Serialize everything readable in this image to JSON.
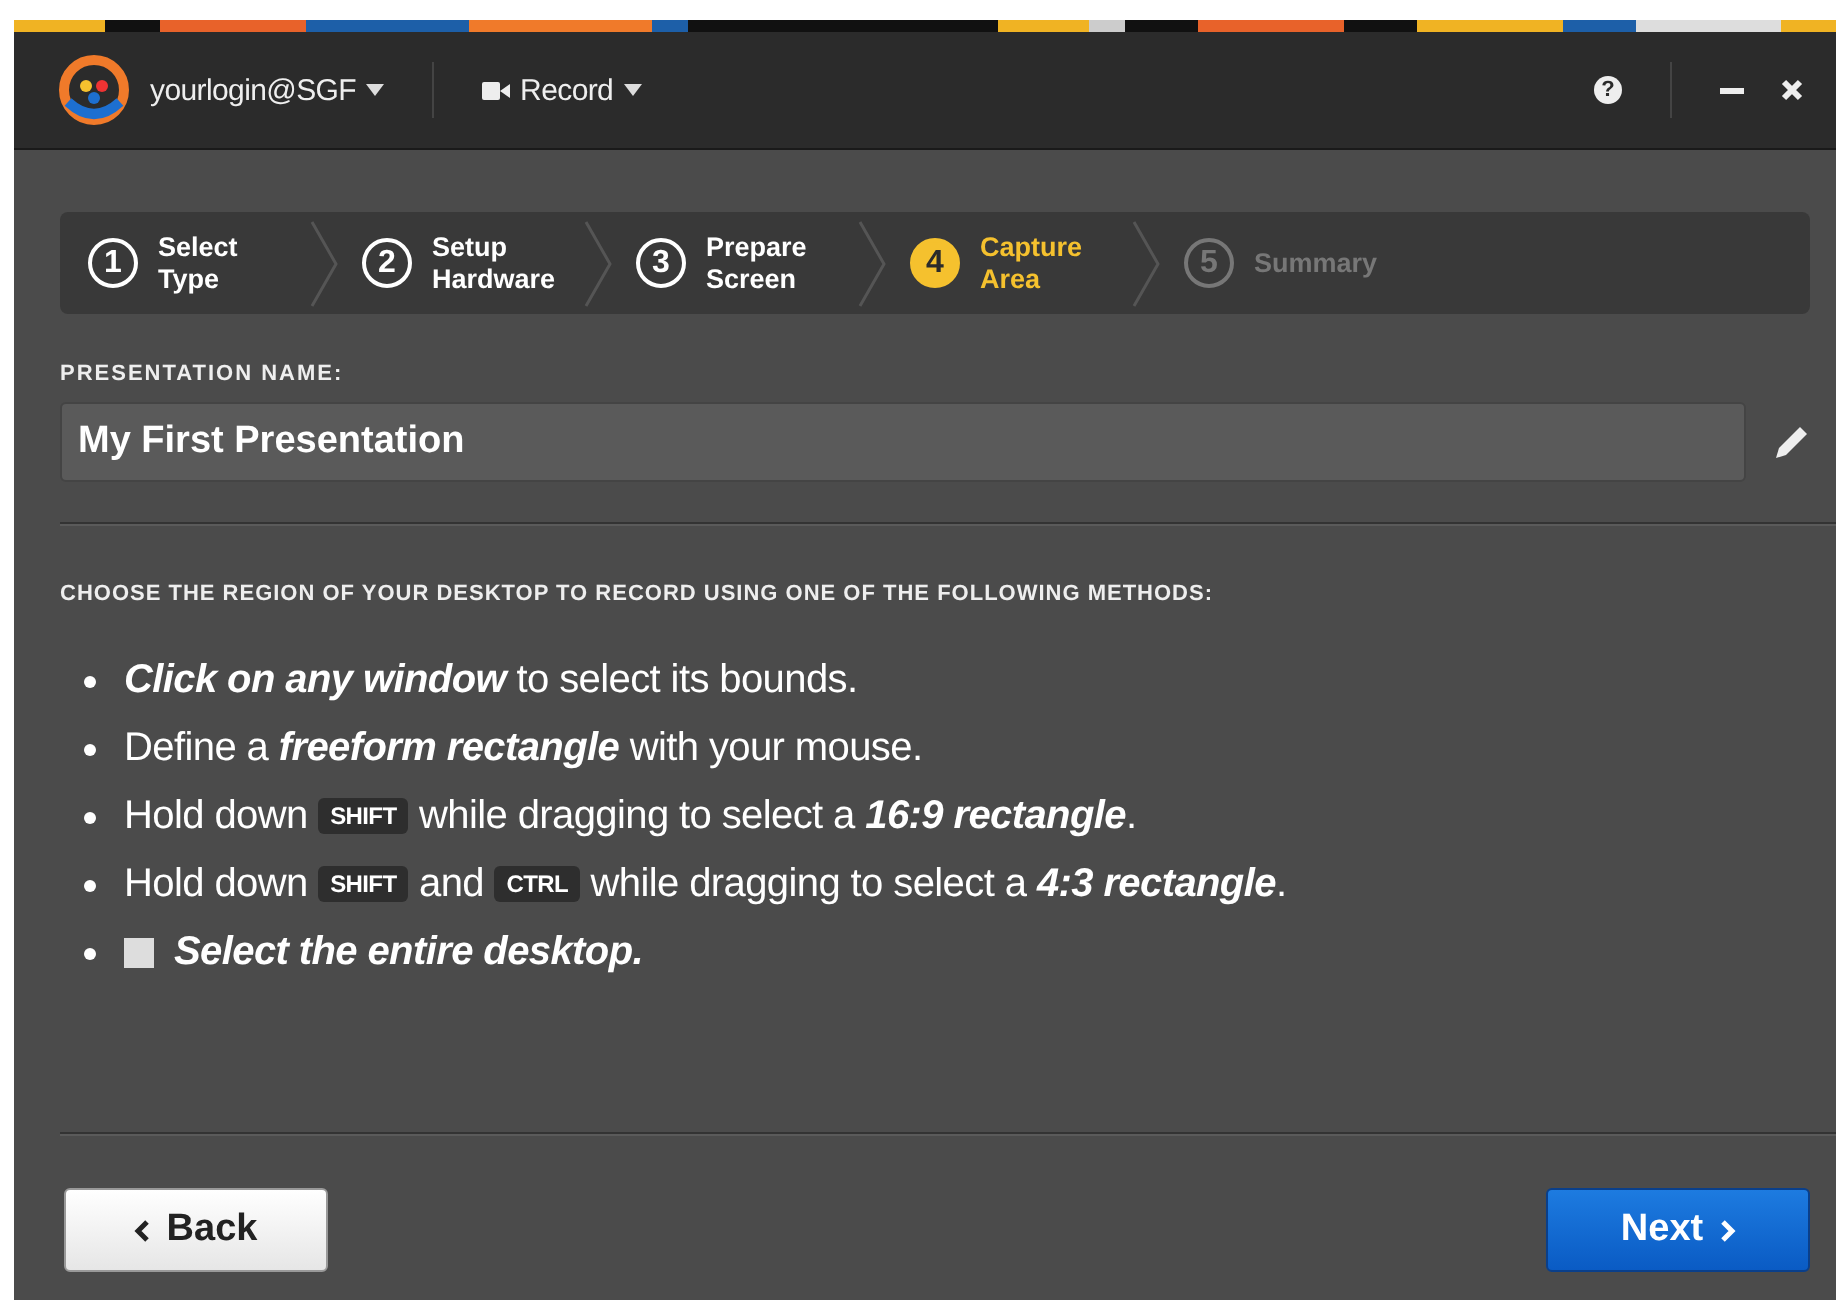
{
  "titlebar": {
    "account": "yourlogin@SGF",
    "mode": "Record",
    "help": "?"
  },
  "steps": [
    {
      "number": "1",
      "label": "Select Type",
      "selected": false,
      "disabled": false
    },
    {
      "number": "2",
      "label": "Setup Hardware",
      "selected": false,
      "disabled": false
    },
    {
      "number": "3",
      "label": "Prepare Screen",
      "selected": false,
      "disabled": false
    },
    {
      "number": "4",
      "label": "Capture Area",
      "selected": true,
      "disabled": false
    },
    {
      "number": "5",
      "label": "Summary",
      "selected": false,
      "disabled": true
    }
  ],
  "name_field": {
    "label": "PRESENTATION NAME:",
    "value": "My First Presentation"
  },
  "instructions": {
    "heading": "CHOOSE THE REGION OF YOUR DESKTOP TO RECORD USING ONE OF THE FOLLOWING METHODS:",
    "items": [
      {
        "parts": [
          {
            "kind": "text",
            "text": "**Click on any window** to select its bounds."
          }
        ]
      },
      {
        "parts": [
          {
            "kind": "text",
            "text": "Define a **freeform rectangle** with your mouse."
          }
        ]
      },
      {
        "parts": [
          {
            "kind": "text",
            "text": "Hold down "
          },
          {
            "kind": "key",
            "text": "SHIFT"
          },
          {
            "kind": "text",
            "text": " while dragging to select a **16:9 rectangle**."
          }
        ]
      },
      {
        "parts": [
          {
            "kind": "text",
            "text": "Hold down "
          },
          {
            "kind": "key",
            "text": "SHIFT"
          },
          {
            "kind": "text",
            "text": " and "
          },
          {
            "kind": "key",
            "text": "CTRL"
          },
          {
            "kind": "text",
            "text": " while dragging to select a **4:3 rectangle**."
          }
        ]
      },
      {
        "parts": [
          {
            "kind": "square"
          },
          {
            "kind": "text",
            "text": "**Select the entire desktop.**"
          }
        ]
      }
    ]
  },
  "buttons": {
    "back": "Back",
    "next": "Next"
  }
}
